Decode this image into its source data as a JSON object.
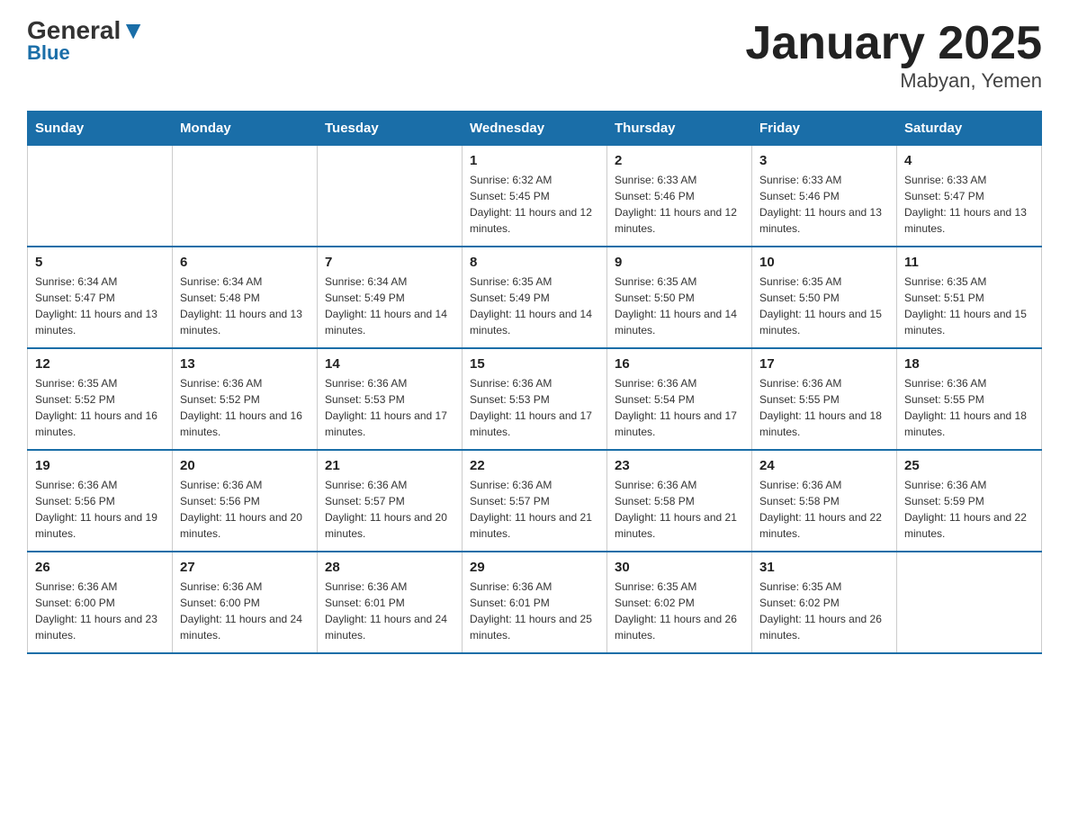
{
  "logo": {
    "general": "General",
    "blue": "Blue"
  },
  "title": "January 2025",
  "subtitle": "Mabyan, Yemen",
  "days_of_week": [
    "Sunday",
    "Monday",
    "Tuesday",
    "Wednesday",
    "Thursday",
    "Friday",
    "Saturday"
  ],
  "weeks": [
    [
      {
        "day": "",
        "info": ""
      },
      {
        "day": "",
        "info": ""
      },
      {
        "day": "",
        "info": ""
      },
      {
        "day": "1",
        "info": "Sunrise: 6:32 AM\nSunset: 5:45 PM\nDaylight: 11 hours and 12 minutes."
      },
      {
        "day": "2",
        "info": "Sunrise: 6:33 AM\nSunset: 5:46 PM\nDaylight: 11 hours and 12 minutes."
      },
      {
        "day": "3",
        "info": "Sunrise: 6:33 AM\nSunset: 5:46 PM\nDaylight: 11 hours and 13 minutes."
      },
      {
        "day": "4",
        "info": "Sunrise: 6:33 AM\nSunset: 5:47 PM\nDaylight: 11 hours and 13 minutes."
      }
    ],
    [
      {
        "day": "5",
        "info": "Sunrise: 6:34 AM\nSunset: 5:47 PM\nDaylight: 11 hours and 13 minutes."
      },
      {
        "day": "6",
        "info": "Sunrise: 6:34 AM\nSunset: 5:48 PM\nDaylight: 11 hours and 13 minutes."
      },
      {
        "day": "7",
        "info": "Sunrise: 6:34 AM\nSunset: 5:49 PM\nDaylight: 11 hours and 14 minutes."
      },
      {
        "day": "8",
        "info": "Sunrise: 6:35 AM\nSunset: 5:49 PM\nDaylight: 11 hours and 14 minutes."
      },
      {
        "day": "9",
        "info": "Sunrise: 6:35 AM\nSunset: 5:50 PM\nDaylight: 11 hours and 14 minutes."
      },
      {
        "day": "10",
        "info": "Sunrise: 6:35 AM\nSunset: 5:50 PM\nDaylight: 11 hours and 15 minutes."
      },
      {
        "day": "11",
        "info": "Sunrise: 6:35 AM\nSunset: 5:51 PM\nDaylight: 11 hours and 15 minutes."
      }
    ],
    [
      {
        "day": "12",
        "info": "Sunrise: 6:35 AM\nSunset: 5:52 PM\nDaylight: 11 hours and 16 minutes."
      },
      {
        "day": "13",
        "info": "Sunrise: 6:36 AM\nSunset: 5:52 PM\nDaylight: 11 hours and 16 minutes."
      },
      {
        "day": "14",
        "info": "Sunrise: 6:36 AM\nSunset: 5:53 PM\nDaylight: 11 hours and 17 minutes."
      },
      {
        "day": "15",
        "info": "Sunrise: 6:36 AM\nSunset: 5:53 PM\nDaylight: 11 hours and 17 minutes."
      },
      {
        "day": "16",
        "info": "Sunrise: 6:36 AM\nSunset: 5:54 PM\nDaylight: 11 hours and 17 minutes."
      },
      {
        "day": "17",
        "info": "Sunrise: 6:36 AM\nSunset: 5:55 PM\nDaylight: 11 hours and 18 minutes."
      },
      {
        "day": "18",
        "info": "Sunrise: 6:36 AM\nSunset: 5:55 PM\nDaylight: 11 hours and 18 minutes."
      }
    ],
    [
      {
        "day": "19",
        "info": "Sunrise: 6:36 AM\nSunset: 5:56 PM\nDaylight: 11 hours and 19 minutes."
      },
      {
        "day": "20",
        "info": "Sunrise: 6:36 AM\nSunset: 5:56 PM\nDaylight: 11 hours and 20 minutes."
      },
      {
        "day": "21",
        "info": "Sunrise: 6:36 AM\nSunset: 5:57 PM\nDaylight: 11 hours and 20 minutes."
      },
      {
        "day": "22",
        "info": "Sunrise: 6:36 AM\nSunset: 5:57 PM\nDaylight: 11 hours and 21 minutes."
      },
      {
        "day": "23",
        "info": "Sunrise: 6:36 AM\nSunset: 5:58 PM\nDaylight: 11 hours and 21 minutes."
      },
      {
        "day": "24",
        "info": "Sunrise: 6:36 AM\nSunset: 5:58 PM\nDaylight: 11 hours and 22 minutes."
      },
      {
        "day": "25",
        "info": "Sunrise: 6:36 AM\nSunset: 5:59 PM\nDaylight: 11 hours and 22 minutes."
      }
    ],
    [
      {
        "day": "26",
        "info": "Sunrise: 6:36 AM\nSunset: 6:00 PM\nDaylight: 11 hours and 23 minutes."
      },
      {
        "day": "27",
        "info": "Sunrise: 6:36 AM\nSunset: 6:00 PM\nDaylight: 11 hours and 24 minutes."
      },
      {
        "day": "28",
        "info": "Sunrise: 6:36 AM\nSunset: 6:01 PM\nDaylight: 11 hours and 24 minutes."
      },
      {
        "day": "29",
        "info": "Sunrise: 6:36 AM\nSunset: 6:01 PM\nDaylight: 11 hours and 25 minutes."
      },
      {
        "day": "30",
        "info": "Sunrise: 6:35 AM\nSunset: 6:02 PM\nDaylight: 11 hours and 26 minutes."
      },
      {
        "day": "31",
        "info": "Sunrise: 6:35 AM\nSunset: 6:02 PM\nDaylight: 11 hours and 26 minutes."
      },
      {
        "day": "",
        "info": ""
      }
    ]
  ]
}
